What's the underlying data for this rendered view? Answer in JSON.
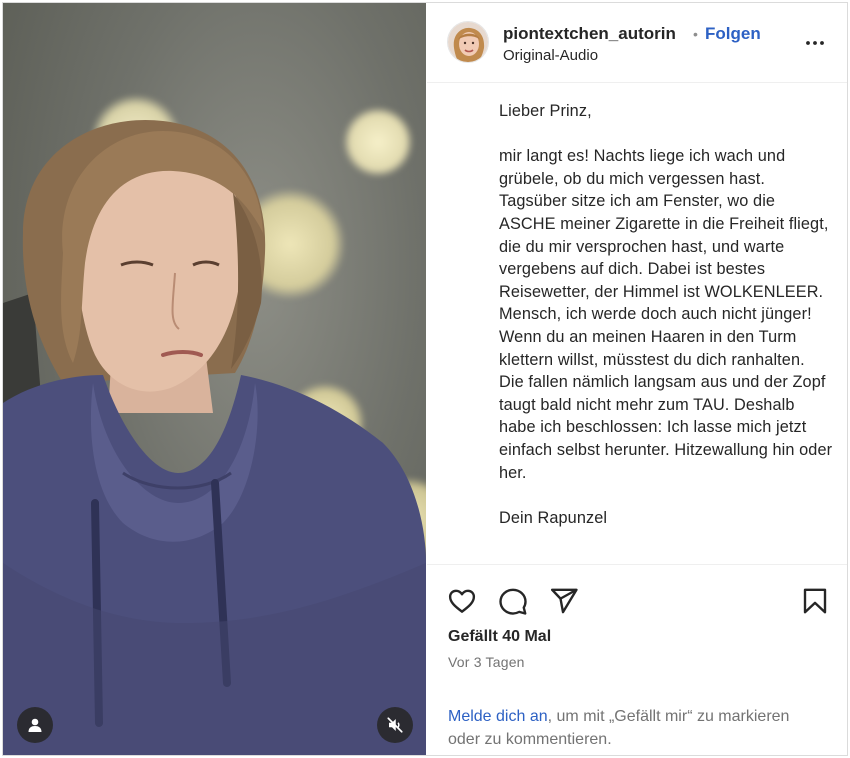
{
  "post": {
    "username": "piontextchen_autorin",
    "separator": "•",
    "follow_label": "Folgen",
    "audio_label": "Original-Audio"
  },
  "caption": {
    "greeting": "Lieber Prinz,",
    "body": "mir langt es! Nachts liege ich wach und grübele, ob du mich vergessen hast. Tagsüber sitze ich am Fenster, wo die ASCHE meiner Zigarette in die Freiheit fliegt, die du mir versprochen hast, und warte vergebens auf dich. Dabei ist bestes Reisewetter, der Himmel ist WOLKENLEER. Mensch, ich werde doch auch nicht jünger! Wenn du an meinen Haaren in den Turm klettern willst, müsstest du dich ranhalten. Die fallen nämlich langsam aus und der Zopf taugt bald nicht mehr zum TAU. Deshalb habe ich beschlossen: Ich lasse mich jetzt einfach selbst herunter. Hitzewallung hin oder her.",
    "signature": "Dein Rapunzel"
  },
  "engagement": {
    "likes_label": "Gefällt 40 Mal",
    "date_label": "Vor 3 Tagen"
  },
  "login_prompt": {
    "link_text": "Melde dich an",
    "rest_text": ", um mit „Gefällt mir“ zu markieren oder zu kommentieren."
  },
  "icons": {
    "more": "more-options-icon",
    "like": "heart-icon",
    "comment": "comment-icon",
    "share": "share-icon",
    "save": "bookmark-icon",
    "user": "user-icon",
    "mute": "muted-speaker-icon"
  },
  "colors": {
    "link": "#2d61c4",
    "text": "#262626",
    "muted": "#737373",
    "sweater": "#4c4f7c"
  }
}
